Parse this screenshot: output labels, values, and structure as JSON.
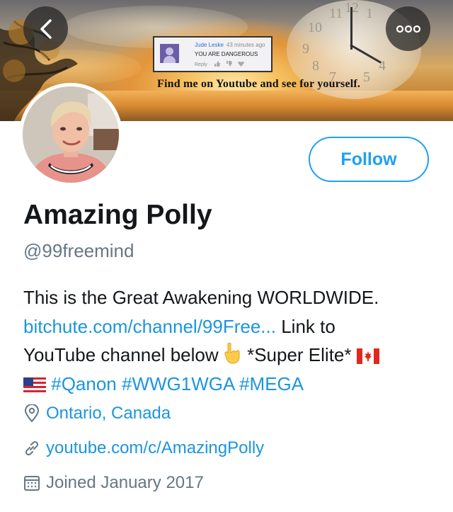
{
  "header": {
    "back_icon": "chevron-left-icon",
    "more_icon": "more-horizontal-icon",
    "banner": {
      "comment": {
        "author": "Jude Leske",
        "time": "43 minutes ago",
        "text": "YOU ARE DANGEROUS",
        "reply": "Reply ·"
      },
      "clock_numbers": [
        "11",
        "12",
        "1",
        "10",
        "9",
        "8",
        "4",
        "7",
        "5"
      ],
      "caption": "Find me on Youtube and see for yourself."
    }
  },
  "profile": {
    "display_name": "Amazing Polly",
    "handle": "@99freemind",
    "follow_label": "Follow",
    "bio": {
      "line1": "This is the Great Awakening WORLDWIDE.",
      "link": "bitchute.com/channel/99Free...",
      "line2_rest": " Link to",
      "line3_a": "YouTube channel below ",
      "line3_b": " *Super Elite* ",
      "hashtags": "#Qanon #WWG1WGA #MEGA"
    },
    "location": "Ontario, Canada",
    "url": "youtube.com/c/AmazingPolly",
    "joined": "Joined January 2017"
  },
  "colors": {
    "accent": "#1da1f2",
    "link": "#1b95e0",
    "secondary_text": "#657786",
    "primary_text": "#14171a"
  },
  "icons": [
    "chevron-left-icon",
    "more-horizontal-icon",
    "pointing-down-emoji",
    "canada-flag-emoji",
    "us-flag-emoji",
    "location-pin-icon",
    "link-icon",
    "calendar-icon"
  ]
}
